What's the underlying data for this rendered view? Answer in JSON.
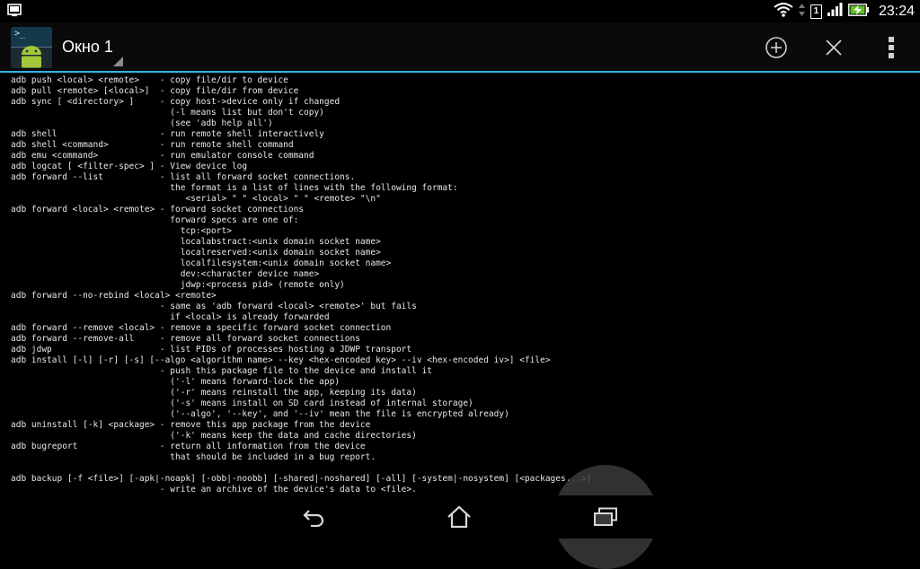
{
  "status_bar": {
    "notification_icon": "screen-icon",
    "wifi_icon": "wifi-icon",
    "data_arrows_icon": "data-arrows-icon",
    "sim_label": "1",
    "signal_icon": "signal-icon",
    "battery_icon": "battery-charging-icon",
    "time": "23:24"
  },
  "action_bar": {
    "app_icon": "terminal-app-icon",
    "app_icon_prompt": ">_",
    "window_title": "Окно 1",
    "new_window_icon": "add-circle-icon",
    "close_window_icon": "close-icon",
    "overflow_icon": "more-vert-icon"
  },
  "terminal": {
    "lines": [
      "adb push <local> <remote>    - copy file/dir to device",
      "adb pull <remote> [<local>]  - copy file/dir from device",
      "adb sync [ <directory> ]     - copy host->device only if changed",
      "                               (-l means list but don't copy)",
      "                               (see 'adb help all')",
      "adb shell                    - run remote shell interactively",
      "adb shell <command>          - run remote shell command",
      "adb emu <command>            - run emulator console command",
      "adb logcat [ <filter-spec> ] - View device log",
      "adb forward --list           - list all forward socket connections.",
      "                               the format is a list of lines with the following format:",
      "                                  <serial> \" \" <local> \" \" <remote> \"\\n\"",
      "adb forward <local> <remote> - forward socket connections",
      "                               forward specs are one of:",
      "                                 tcp:<port>",
      "                                 localabstract:<unix domain socket name>",
      "                                 localreserved:<unix domain socket name>",
      "                                 localfilesystem:<unix domain socket name>",
      "                                 dev:<character device name>",
      "                                 jdwp:<process pid> (remote only)",
      "adb forward --no-rebind <local> <remote>",
      "                             - same as 'adb forward <local> <remote>' but fails",
      "                               if <local> is already forwarded",
      "adb forward --remove <local> - remove a specific forward socket connection",
      "adb forward --remove-all     - remove all forward socket connections",
      "adb jdwp                     - list PIDs of processes hosting a JDWP transport",
      "adb install [-l] [-r] [-s] [--algo <algorithm name> --key <hex-encoded key> --iv <hex-encoded iv>] <file>",
      "                             - push this package file to the device and install it",
      "                               ('-l' means forward-lock the app)",
      "                               ('-r' means reinstall the app, keeping its data)",
      "                               ('-s' means install on SD card instead of internal storage)",
      "                               ('--algo', '--key', and '--iv' mean the file is encrypted already)",
      "adb uninstall [-k] <package> - remove this app package from the device",
      "                               ('-k' means keep the data and cache directories)",
      "adb bugreport                - return all information from the device",
      "                               that should be included in a bug report.",
      "",
      "adb backup [-f <file>] [-apk|-noapk] [-obb|-noobb] [-shared|-noshared] [-all] [-system|-nosystem] [<packages...>]",
      "                             - write an archive of the device's data to <file>."
    ]
  },
  "nav_bar": {
    "back_icon": "back-icon",
    "home_icon": "home-icon",
    "recents_icon": "recents-icon"
  }
}
